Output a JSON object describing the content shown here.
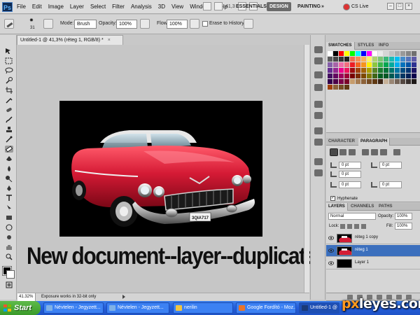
{
  "app": {
    "logo": "Ps"
  },
  "menu": [
    "File",
    "Edit",
    "Image",
    "Layer",
    "Select",
    "Filter",
    "Analysis",
    "3D",
    "View",
    "Window",
    "Help"
  ],
  "zoom_control": {
    "value": "41,3"
  },
  "workspaces": [
    "ESSENTIALS",
    "DESIGN",
    "PAINTING"
  ],
  "active_workspace": "DESIGN",
  "cs_live": "CS Live",
  "options": {
    "brush_size": "31",
    "mode_label": "Mode:",
    "mode_value": "Brush",
    "opacity_label": "Opacity:",
    "opacity_value": "100%",
    "flow_label": "Flow:",
    "flow_value": "100%",
    "erase_history_label": "Erase to History"
  },
  "document": {
    "tab_title": "Untitled-1 @ 41,3% (réteg 1, RGB/8) *",
    "close": "×"
  },
  "caption": "New document--layer--duplicate layer",
  "license_plate": "3QIA717",
  "status": {
    "zoom": "41.32%",
    "message": "Exposure works in 32-bit only"
  },
  "swatches_panel": {
    "tabs": [
      "SWATCHES",
      "STYLES",
      "INFO"
    ],
    "colors": [
      "#ffffff",
      "#000000",
      "#ff0000",
      "#ffff00",
      "#00ff00",
      "#00ffff",
      "#0000ff",
      "#ff00ff",
      "#ffffff",
      "#ebebeb",
      "#d6d6d6",
      "#c2c2c2",
      "#adadad",
      "#999999",
      "#858585",
      "#707070",
      "#5c5c5c",
      "#474747",
      "#333333",
      "#1f1f1f",
      "#f26c4f",
      "#f68e55",
      "#fbaf5c",
      "#fff467",
      "#acd372",
      "#7cc576",
      "#3bb878",
      "#1abbb4",
      "#00bff3",
      "#438ccb",
      "#5574b9",
      "#605ca8",
      "#855fa8",
      "#a763a8",
      "#f06ea9",
      "#f26d7d",
      "#ed1c24",
      "#f26522",
      "#f7941d",
      "#fff200",
      "#8dc73f",
      "#39b54a",
      "#00a651",
      "#00a99d",
      "#00aeef",
      "#0072bc",
      "#0054a6",
      "#2e3192",
      "#662d91",
      "#92278f",
      "#ec008c",
      "#ed145b",
      "#9e0b0f",
      "#a0410d",
      "#a36209",
      "#aba000",
      "#598527",
      "#1a7b30",
      "#007236",
      "#00746b",
      "#0076a3",
      "#004b80",
      "#003471",
      "#1b1464",
      "#440e62",
      "#630460",
      "#9e005d",
      "#9e0039",
      "#790000",
      "#7b2e00",
      "#7d4900",
      "#827b00",
      "#406618",
      "#005e20",
      "#005826",
      "#005952",
      "#005b7f",
      "#003663",
      "#002157",
      "#0d004c",
      "#32004b",
      "#4b0049",
      "#7b0046",
      "#7a0026",
      "#c69c6d",
      "#a67c52",
      "#8c6239",
      "#754c24",
      "#603913",
      "#3c2415",
      "#c7b299",
      "#998675",
      "#736357",
      "#534741",
      "#362f2d",
      "#1e1a18",
      "#a0410d",
      "#8c6239",
      "#754c24",
      "#603913"
    ]
  },
  "character_panel": {
    "tabs": [
      "CHARACTER",
      "PARAGRAPH"
    ],
    "indent_left": "0 pt",
    "indent_right": "0 pt",
    "first_line": "0 pt",
    "space_before": "0 pt",
    "space_after": "0 pt",
    "hyphenate_label": "Hyphenate",
    "hyphenate_checked": "✓"
  },
  "layers_panel": {
    "tabs": [
      "LAYERS",
      "CHANNELS",
      "PATHS"
    ],
    "blend_mode": "Normal",
    "opacity_label": "Opacity:",
    "opacity_value": "100%",
    "lock_label": "Lock:",
    "fill_label": "Fill:",
    "fill_value": "100%",
    "layers": [
      {
        "name": "réteg 1 copy",
        "selected": false,
        "thumb": "car"
      },
      {
        "name": "réteg 1",
        "selected": true,
        "thumb": "car"
      },
      {
        "name": "Layer 1",
        "selected": false,
        "thumb": "black"
      }
    ]
  },
  "taskbar": {
    "start": "Start",
    "items": [
      {
        "label": "Névtelen - Jegyzett...",
        "icon_color": "#7fb1e6"
      },
      {
        "label": "Névtelen - Jegyzett...",
        "icon_color": "#7fb1e6"
      },
      {
        "label": "nerilin",
        "icon_color": "#f1c542"
      },
      {
        "label": "Google Fordító - Moz...",
        "icon_color": "#e8742a"
      },
      {
        "label": "Untitled-1 @ 4...",
        "icon_color": "#1a3a78"
      }
    ]
  },
  "watermark": {
    "prefix": "px",
    "suffix": "leyes.com"
  }
}
